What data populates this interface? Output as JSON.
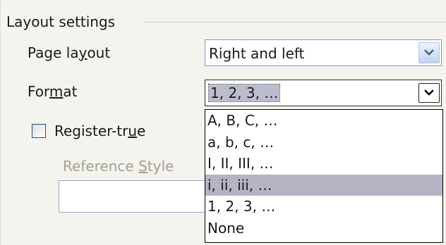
{
  "group": {
    "title": "Layout settings"
  },
  "page_layout": {
    "label_pre": "Page la",
    "label_mnemonic": "y",
    "label_post": "out",
    "value": "Right and left"
  },
  "format": {
    "label_pre": "For",
    "label_mnemonic": "m",
    "label_post": "at",
    "value": "1, 2, 3, …",
    "options": [
      "A, B, C, …",
      "a, b, c, …",
      "I, II, III, …",
      "i, ii, iii, …",
      "1, 2, 3, …",
      "None"
    ],
    "highlighted": "i, ii, iii, …"
  },
  "register_true": {
    "label_pre": "Register-tr",
    "label_mnemonic": "u",
    "label_post": "e",
    "checked": false
  },
  "reference_style": {
    "label_pre": "Reference ",
    "label_mnemonic": "S",
    "label_post": "tyle",
    "value": ""
  },
  "icons": {
    "combo_button": "chevron-down-icon"
  }
}
